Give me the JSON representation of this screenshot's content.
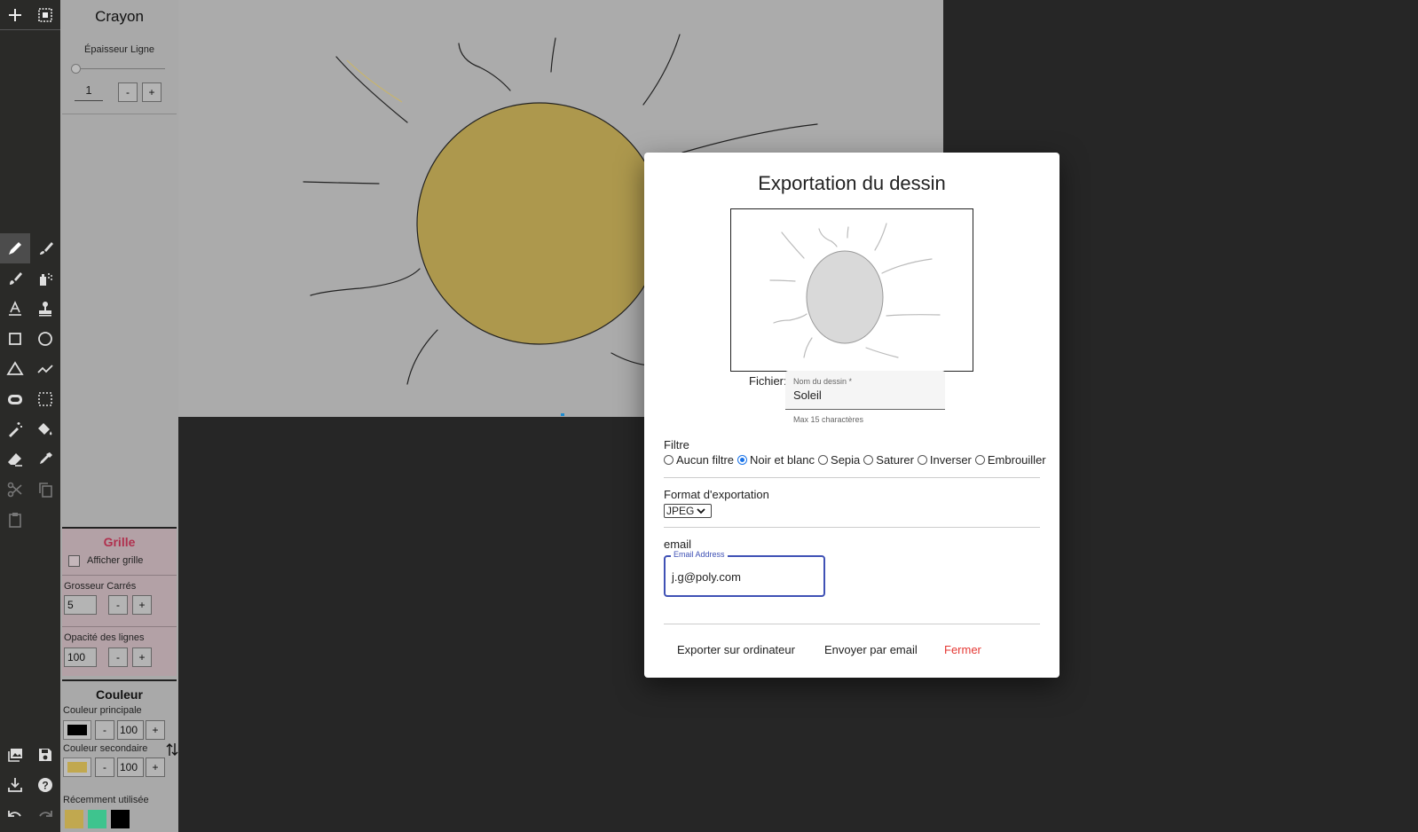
{
  "toolbar": {
    "top": [
      "add-icon",
      "select-all-icon"
    ],
    "tools": [
      "pencil-icon",
      "brush-icon",
      "paint-brush-icon",
      "spray-icon",
      "text-icon",
      "stamp-icon",
      "rectangle-icon",
      "ellipse-icon",
      "triangle-icon",
      "polyline-icon",
      "filled-ellipse-icon",
      "selection-icon",
      "magic-wand-icon",
      "paint-bucket-icon",
      "eraser-icon",
      "eyedropper-icon",
      "cut-icon",
      "copy-icon",
      "paste-icon"
    ],
    "bottom": [
      "gallery-icon",
      "save-icon",
      "export-icon",
      "help-icon",
      "undo-icon",
      "redo-icon"
    ]
  },
  "panel": {
    "title": "Crayon",
    "thickness_label": "Épaisseur Ligne",
    "thickness_value": "1",
    "minus": "-",
    "plus": "+"
  },
  "grid": {
    "title": "Grille",
    "show_label": "Afficher grille",
    "size_label": "Grosseur Carrés",
    "size_value": "5",
    "opacity_label": "Opacité des lignes",
    "opacity_value": "100"
  },
  "color": {
    "title": "Couleur",
    "primary_label": "Couleur principale",
    "primary_color": "#000000",
    "primary_opacity": "100",
    "secondary_label": "Couleur secondaire",
    "secondary_color": "#c1a84f",
    "secondary_opacity": "100",
    "recent_label": "Récemment utilisée",
    "recent": [
      "#c1a84f",
      "#3ec48e",
      "#000000"
    ]
  },
  "dialog": {
    "title": "Exportation du dessin",
    "file_label": "Fichier:",
    "name_field_label": "Nom du dessin *",
    "name_value": "Soleil",
    "name_hint": "Max 15 charactères",
    "filter_label": "Filtre",
    "filters": [
      "Aucun filtre",
      "Noir et blanc",
      "Sepia",
      "Saturer",
      "Inverser",
      "Embrouiller"
    ],
    "selected_filter": "Noir et blanc",
    "format_label": "Format d'exportation",
    "format_value": "JPEG",
    "email_section": "email",
    "email_field_label": "Email Address",
    "email_value": "j.g@poly.com",
    "btn_export": "Exporter sur ordinateur",
    "btn_email": "Envoyer par email",
    "btn_close": "Fermer"
  }
}
